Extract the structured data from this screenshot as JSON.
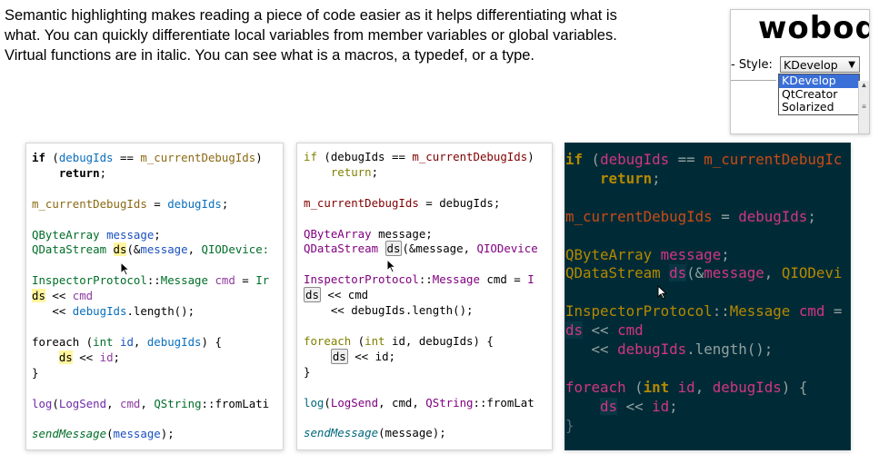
{
  "intro": {
    "line1": "Semantic highlighting makes reading a piece of code easier as it helps differentiating what is",
    "line2": "what. You can quickly differentiate local variables from member variables or global variables.",
    "line3": "Virtual functions are in italic. You can see what is a macros, a typedef, or a type."
  },
  "logo": {
    "text": "woboq"
  },
  "style_selector": {
    "label": "- Style:",
    "selected": "KDevelop",
    "arrow": "▼",
    "options": [
      "KDevelop",
      "QtCreator",
      "Solarized"
    ]
  },
  "panels": {
    "kdevelop": {
      "l1": {
        "kw": "if",
        "p": " (",
        "a": "debugIds",
        "op": " == ",
        "m": "m_currentDebugIds",
        "c": ")"
      },
      "l2": {
        "ind": "    ",
        "kw": "return",
        "c": ";"
      },
      "l4": {
        "m": "m_currentDebugIds",
        "op": " = ",
        "a": "debugIds",
        "c": ";"
      },
      "l6": {
        "t": "QByteArray",
        "sp": " ",
        "v": "message",
        "c": ";"
      },
      "l7": {
        "t": "QDataStream",
        "sp": " ",
        "v": "ds",
        "c1": "(&",
        "v2": "message",
        "c2": ", ",
        "t2": "QIODevice:"
      },
      "l9": {
        "t": "InspectorProtocol",
        "c1": "::",
        "t2": "Message",
        "sp": " ",
        "v": "cmd",
        "c2": " = ",
        "tail": "Ir"
      },
      "l10": {
        "v": "ds",
        "op": " << ",
        "v2": "cmd"
      },
      "l11": {
        "ind": "   ",
        "op": "<< ",
        "v": "debugIds",
        "c": ".length();"
      },
      "l13": {
        "kw": "foreach",
        "c1": " (",
        "t": "int",
        "sp": " ",
        "v": "id",
        "c2": ", ",
        "v2": "debugIds",
        "c3": ") {"
      },
      "l14": {
        "ind": "    ",
        "v": "ds",
        "op": " << ",
        "v2": "id",
        "c": ";"
      },
      "l15": {
        "c": "}"
      },
      "l17": {
        "f": "log",
        "c1": "(",
        "e": "LogSend",
        "c2": ", ",
        "v": "cmd",
        "c3": ", ",
        "t": "QString",
        "c4": "::",
        "f2": "fromLati"
      },
      "l19": {
        "f": "sendMessage",
        "c1": "(",
        "v": "message",
        "c2": ");"
      }
    },
    "qtcreator": {
      "l1": {
        "kw": "if",
        "p": " (debugIds == ",
        "m": "m_currentDebugIds",
        "c": ")"
      },
      "l2": {
        "ind": "    ",
        "kw": "return",
        "c": ";"
      },
      "l4": {
        "m": "m_currentDebugIds",
        "c": " = debugIds;"
      },
      "l6": {
        "t": "QByteArray",
        "c": " message;"
      },
      "l7": {
        "t": "QDataStream",
        "sp": " ",
        "v": "ds",
        "c": "(&message, ",
        "t2": "QIODevice"
      },
      "l9": {
        "t": "InspectorProtocol",
        "c1": "::",
        "t2": "Message",
        "c2": " cmd = ",
        "tail": "I"
      },
      "l10": {
        "v": "ds",
        "c": " << cmd"
      },
      "l11": {
        "c": "    << debugIds.length();"
      },
      "l13": {
        "kw": "foreach",
        "c1": " (",
        "t": "int",
        "c2": " id, debugIds) {"
      },
      "l14": {
        "ind": "    ",
        "v": "ds",
        "c": " << id;"
      },
      "l15": {
        "c": "}"
      },
      "l17": {
        "f": "log",
        "c1": "(",
        "e": "LogSend",
        "c2": ", cmd, ",
        "t": "QString",
        "c3": "::fromLat"
      },
      "l19": {
        "f": "sendMessage",
        "c": "(message);"
      }
    },
    "solarized": {
      "l1": {
        "kw": "if",
        "p": " (",
        "a": "debugIds",
        "op": " == ",
        "m": "m_currentDebugIc"
      },
      "l2": {
        "ind": "    ",
        "kw": "return",
        "c": ";"
      },
      "l4": {
        "m": "m_currentDebugIds",
        "op": " = ",
        "a": "debugIds",
        "c": ";"
      },
      "l6": {
        "t": "QByteArray",
        "sp": " ",
        "v": "message",
        "c": ";"
      },
      "l7": {
        "t": "QDataStream",
        "sp": " ",
        "v": "ds",
        "c1": "(&",
        "v2": "message",
        "c2": ", ",
        "t2": "QIODevi"
      },
      "l9": {
        "t": "InspectorProtocol",
        "c1": "::",
        "t2": "Message",
        "sp": " ",
        "v": "cmd",
        "tail": " ="
      },
      "l10": {
        "v": "ds",
        "op": " << ",
        "v2": "cmd"
      },
      "l11": {
        "ind": "   ",
        "op": "<< ",
        "v": "debugIds",
        "c": ".length();"
      },
      "l13": {
        "kw": "foreach",
        "c1": " (",
        "t": "int",
        "sp": " ",
        "v": "id",
        "c2": ", ",
        "v2": "debugIds",
        "c3": ") {"
      },
      "l14": {
        "ind": "    ",
        "v": "ds",
        "op": " << ",
        "v2": "id",
        "c": ";"
      },
      "l15": {
        "c": "}"
      }
    }
  }
}
